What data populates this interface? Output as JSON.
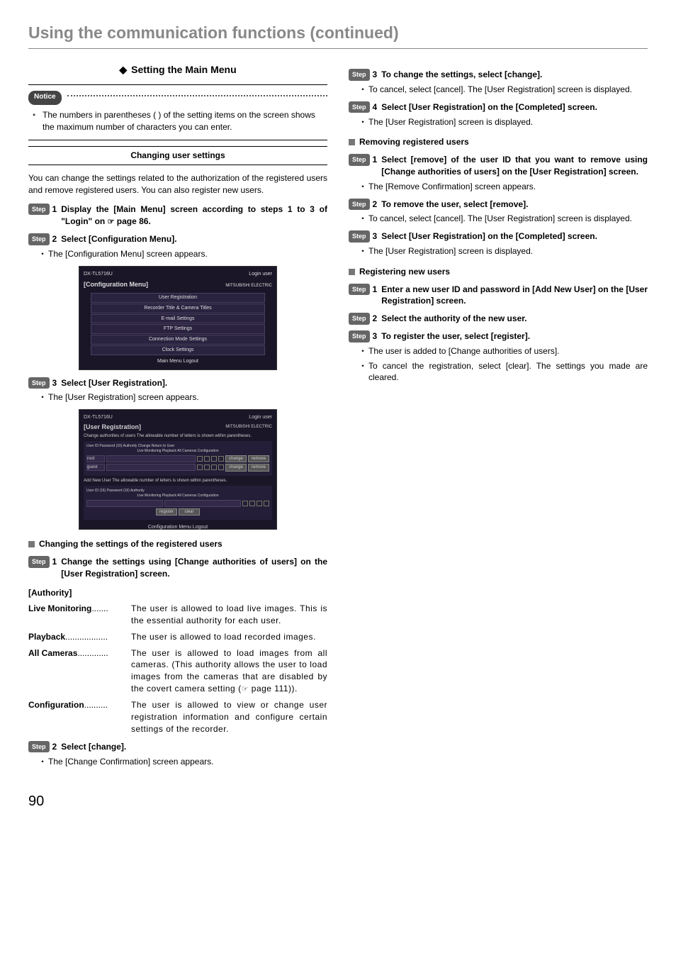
{
  "page_title": "Using the communication functions (continued)",
  "section_header": "Setting the Main Menu",
  "notice_label": "Notice",
  "notice_text": "The numbers in parentheses ( ) of the setting items on the screen shows the maximum number of characters you can enter.",
  "sub_heading": "Changing user settings",
  "intro_text": "You can change the settings related to the authorization of the registered users and remove registered users. You can also register new users.",
  "step_label": "Step",
  "left_steps": {
    "s1": "Display the [Main Menu] screen according to steps 1 to 3 of \"Login\" on ",
    "s1_ref": " page 86.",
    "s2": "Select [Configuration Menu].",
    "s2_bullet": "The [Configuration Menu] screen appears.",
    "s3": "Select [User Registration].",
    "s3_bullet": "The [User Registration] screen appears."
  },
  "mock1": {
    "model": "DX-TL5716U",
    "login": "Login user",
    "brand": "MITSUBISHI ELECTRIC",
    "title": "[Configuration Menu]",
    "rows": [
      "User Registration",
      "Recorder Title & Camera Titles",
      "E-mail Settings",
      "FTP Settings",
      "Connection Mode Settings",
      "Clock Settings"
    ],
    "bottom": "Main Menu  Logout"
  },
  "mock2": {
    "model": "DX-TL5716U",
    "login": "Login user",
    "brand": "MITSUBISHI ELECTRIC",
    "title": "[User Registration]",
    "subtitle": "Change authorities of users    The allowable number of letters is shown within parentheses.",
    "headers": "User ID    Password (16)    Authority    Change  Return to User",
    "auth_cols": "Live Monitoring  Playback  All Cameras  Configuration",
    "add_label": "Add New User    The allowable number of letters is shown within parentheses.",
    "add_headers": "User ID (16)    Password (16)    Authority",
    "btn_change": "change",
    "btn_remove": "remove",
    "btn_register": "register",
    "btn_clear": "clear",
    "bottom": "Configuration Menu  Logout"
  },
  "changing_settings_header": "Changing the settings of the registered users",
  "change_step1": "Change the settings using [Change authorities of users] on the [User Registration] screen.",
  "authority_heading": "[Authority]",
  "authority": [
    {
      "term": "Live Monitoring",
      "dots": ".......",
      "def": "The user is allowed to load live images. This is the essential authority for each user."
    },
    {
      "term": "Playback",
      "dots": "..................",
      "def": "The user is allowed to load recorded images."
    },
    {
      "term": "All Cameras",
      "dots": ".............",
      "def_pre": "The user is allowed to load images from all cameras. (This authority allows the user to load images from the cameras that are disabled by the covert camera setting (",
      "def_post": " page 111))."
    },
    {
      "term": "Configuration",
      "dots": "..........",
      "def": "The user is allowed to view or change user registration information and configure certain settings of the recorder."
    }
  ],
  "left_step2b": "Select [change].",
  "left_step2b_bullet": "The [Change Confirmation] screen appears.",
  "right": {
    "s3": "To change the settings, select [change].",
    "s3_bullet": "To cancel, select [cancel]. The [User Registration] screen is displayed.",
    "s4": "Select [User Registration] on the [Completed] screen.",
    "s4_bullet": "The [User Registration] screen is displayed.",
    "removing_header": "Removing registered users",
    "r1": "Select [remove] of the user ID that you want to remove using [Change authorities of users] on the [User Registration] screen.",
    "r1_bullet": "The [Remove Confirmation] screen appears.",
    "r2": "To remove the user, select [remove].",
    "r2_bullet": "To cancel, select [cancel]. The [User Registration] screen is displayed.",
    "r3": "Select [User Registration] on the [Completed] screen.",
    "r3_bullet": "The [User Registration] screen is displayed.",
    "registering_header": "Registering new users",
    "n1": "Enter a new user ID and password in [Add New User] on the [User Registration] screen.",
    "n2": "Select the authority of the new user.",
    "n3": "To register the user, select [register].",
    "n3_b1": "The user is added to [Change authorities of users].",
    "n3_b2": "To cancel the registration, select [clear]. The settings you made are cleared."
  },
  "page_number": "90",
  "ref_icon": "☞"
}
